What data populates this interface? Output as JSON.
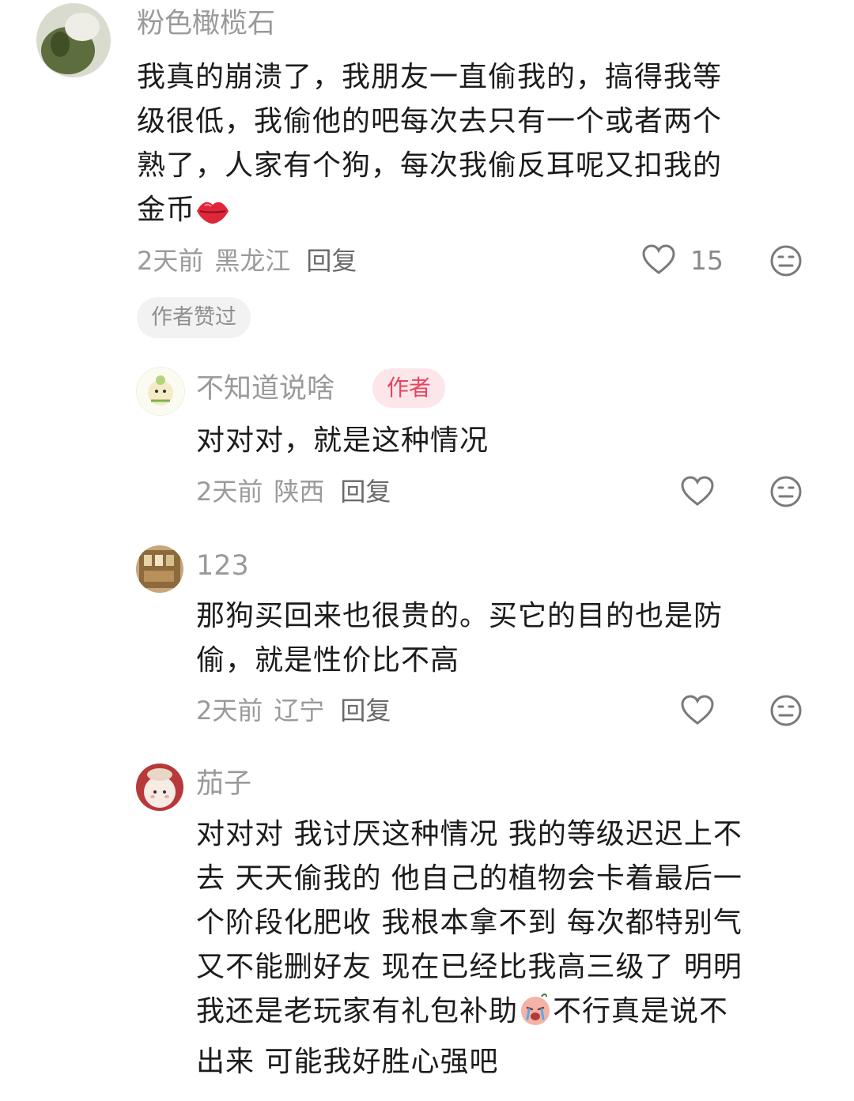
{
  "comments": [
    {
      "username": "粉色橄榄石",
      "lines": [
        "我真的崩溃了，我朋友一直偷我的，搞得我等",
        "级很低，我偷他的吧每次去只有一个或者两个",
        "熟了，人家有个狗，每次我偷反耳呢又扣我的"
      ],
      "last_line": "金币",
      "emoji": "lips-emoji",
      "time": "2天前",
      "location": "黑龙江",
      "reply": "回复",
      "likes": "15",
      "author_liked": "作者赞过"
    },
    {
      "username": "不知道说啥",
      "author_tag": "作者",
      "lines": [
        "对对对，就是这种情况"
      ],
      "time": "2天前",
      "location": "陕西",
      "reply": "回复"
    },
    {
      "username": "123",
      "lines": [
        "那狗买回来也很贵的。买它的目的也是防",
        "偷，就是性价比不高"
      ],
      "time": "2天前",
      "location": "辽宁",
      "reply": "回复"
    },
    {
      "username": "茄子",
      "lines": [
        "对对对 我讨厌这种情况 我的等级迟迟上不",
        "去 天天偷我的 他自己的植物会卡着最后一",
        "个阶段化肥收 我根本拿不到 每次都特别气",
        "又不能删好友 现在已经比我高三级了 明明"
      ],
      "line5_before": "我还是老玩家有礼包补助",
      "line5_emoji": "crying-emoji",
      "line5_after": "不行真是说不",
      "line6": "出来 可能我好胜心强吧"
    }
  ],
  "colors": {
    "username": "#9a9a9a",
    "text": "#1c1c1c",
    "author_tag_bg": "#fde6ea",
    "author_tag_text": "#e8445f"
  }
}
